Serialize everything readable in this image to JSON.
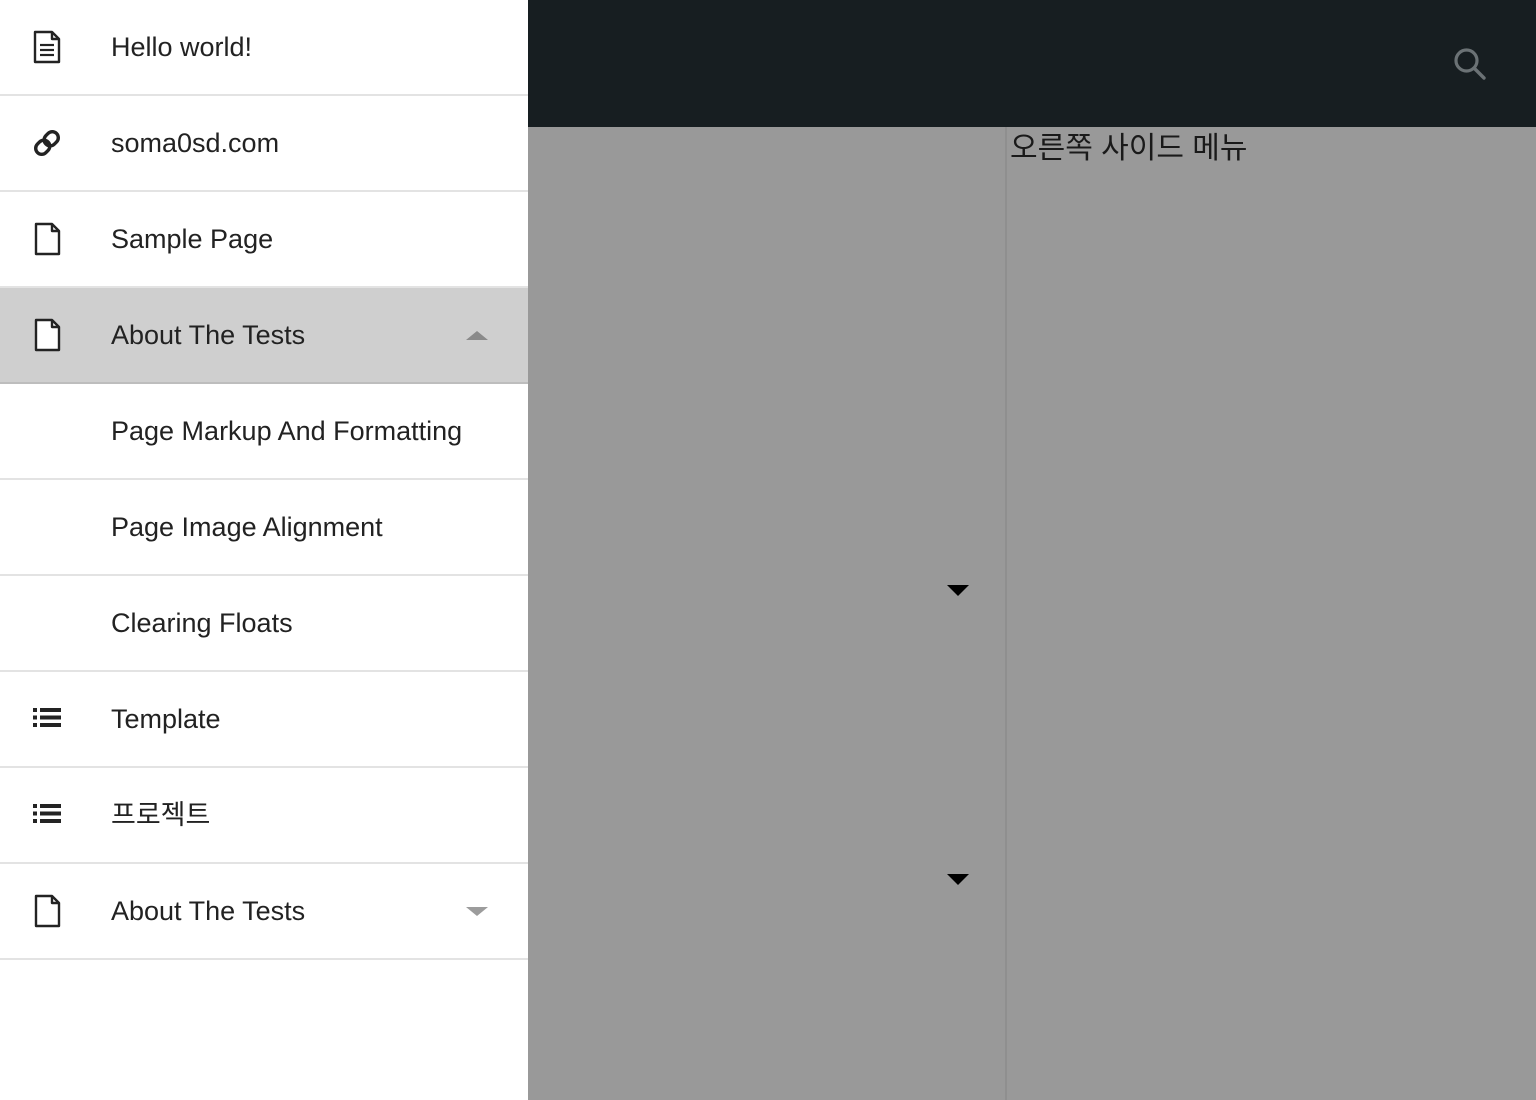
{
  "header": {
    "background_color": "#171e21",
    "search_icon": "search-icon"
  },
  "content": {
    "background_color": "#999999",
    "right_panel_title": "오른쪽 사이드 메뉴",
    "left_select_arrow_1": "chevron-down-icon",
    "left_select_arrow_2": "chevron-down-icon"
  },
  "side_menu": {
    "background_color": "#ffffff",
    "active_background_color": "#cfcfcf",
    "items": [
      {
        "label": "Hello world!",
        "icon": "article-icon",
        "level": "top",
        "active": false,
        "toggle": ""
      },
      {
        "label": "soma0sd.com",
        "icon": "link-icon",
        "level": "top",
        "active": false,
        "toggle": ""
      },
      {
        "label": "Sample Page",
        "icon": "page-icon",
        "level": "top",
        "active": false,
        "toggle": ""
      },
      {
        "label": "About The Tests",
        "icon": "page-icon",
        "level": "top",
        "active": true,
        "toggle": "chevron-up-icon"
      },
      {
        "label": "Page Markup And Formatting",
        "icon": "",
        "level": "sub",
        "active": false,
        "toggle": ""
      },
      {
        "label": "Page Image Alignment",
        "icon": "",
        "level": "sub",
        "active": false,
        "toggle": ""
      },
      {
        "label": "Clearing Floats",
        "icon": "",
        "level": "sub",
        "active": false,
        "toggle": ""
      },
      {
        "label": "Template",
        "icon": "list-icon",
        "level": "top",
        "active": false,
        "toggle": ""
      },
      {
        "label": "프로젝트",
        "icon": "list-icon",
        "level": "top",
        "active": false,
        "toggle": ""
      },
      {
        "label": "About The Tests",
        "icon": "page-icon",
        "level": "top",
        "active": false,
        "toggle": "chevron-down-icon"
      }
    ]
  }
}
